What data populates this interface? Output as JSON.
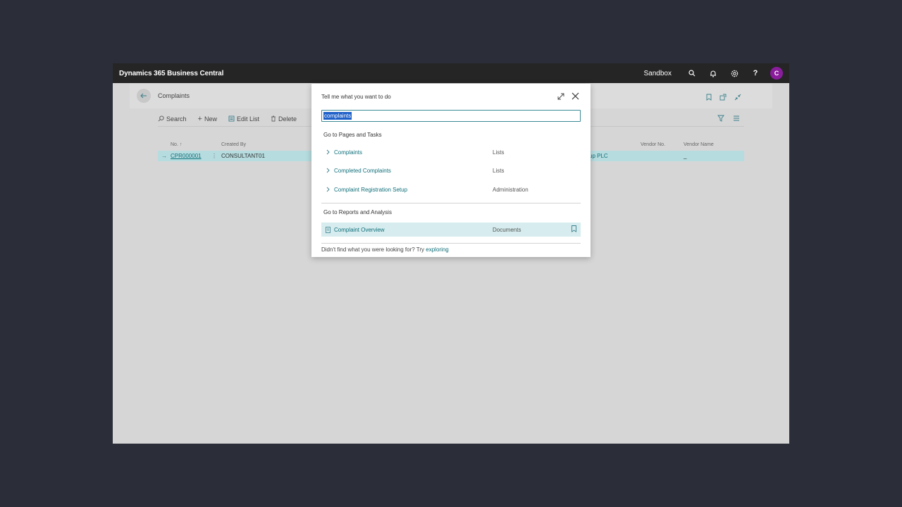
{
  "app": {
    "brand": "Dynamics 365 Business Central",
    "environment": "Sandbox",
    "user_initial": "C",
    "avatar_color": "#8a1d9c"
  },
  "page": {
    "title": "Complaints",
    "actions": [
      "Search",
      "New",
      "Edit List",
      "Delete"
    ],
    "columns": [
      "No. ↑",
      "Created By",
      "Vendor No.",
      "Vendor Name"
    ],
    "row": {
      "no": "CPR000001",
      "created_by": "CONSULTANT01",
      "partial": "up PLC",
      "vendor_name": "_"
    }
  },
  "dialog": {
    "title": "Tell me what you want to do",
    "search_value": "complaints",
    "section_pages": "Go to Pages and Tasks",
    "pages": [
      {
        "name": "Complaints",
        "category": "Lists"
      },
      {
        "name": "Completed Complaints",
        "category": "Lists"
      },
      {
        "name": "Complaint Registration Setup",
        "category": "Administration"
      }
    ],
    "section_reports": "Go to Reports and Analysis",
    "reports": [
      {
        "name": "Complaint Overview",
        "category": "Documents"
      }
    ],
    "footer_text": "Didn't find what you were looking for? Try",
    "footer_link": "exploring"
  },
  "colors": {
    "accent": "#0f6f7a",
    "selection": "#b6dcdf",
    "topbar": "#252525"
  }
}
